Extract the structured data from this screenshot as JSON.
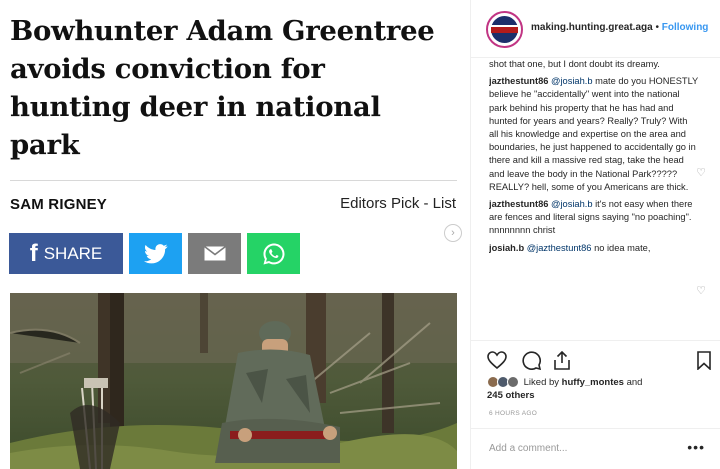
{
  "article": {
    "headline": "Bowhunter Adam Greentree avoids conviction for hunting deer in national park",
    "author": "SAM RIGNEY",
    "category": "Editors Pick - List",
    "share": {
      "facebook_label": "SHARE",
      "facebook_glyph": "f"
    },
    "colors": {
      "facebook": "#3b5998",
      "twitter": "#1da1f2",
      "email": "#7b7b7b",
      "whatsapp": "#25d366"
    }
  },
  "instagram": {
    "username": "making.hunting.great.aga",
    "separator": " • ",
    "follow_label": "Following",
    "comments": [
      {
        "user": "",
        "mention": "",
        "text": "shot that one, but I dont doubt its dreamy."
      },
      {
        "user": "jazthestunt86",
        "mention": "@josiah.b",
        "text": " mate do you HONESTLY believe he \"accidentally\" went into the national park behind his property that he has had and hunted for years and years? Really? Truly? With all his knowledge and expertise on the area and boundaries, he just happened to accidentally go in there and kill a massive red stag, take the head and leave the body in the National Park????? REALLY?          hell, some of you Americans are thick."
      },
      {
        "user": "jazthestunt86",
        "mention": "@josiah.b",
        "text": " it's not easy when there are fences and literal signs saying \"no poaching\".          nnnnnnnn christ"
      },
      {
        "user": "josiah.b",
        "mention": "@jazthestunt86",
        "text": " no idea mate,"
      }
    ],
    "likes_prefix": "Liked by ",
    "likes_user": "huffy_montes",
    "likes_suffix": " and",
    "likes_others": "245 others",
    "time": "6 HOURS AGO",
    "add_comment_placeholder": "Add a comment...",
    "more_glyph": "•••"
  }
}
